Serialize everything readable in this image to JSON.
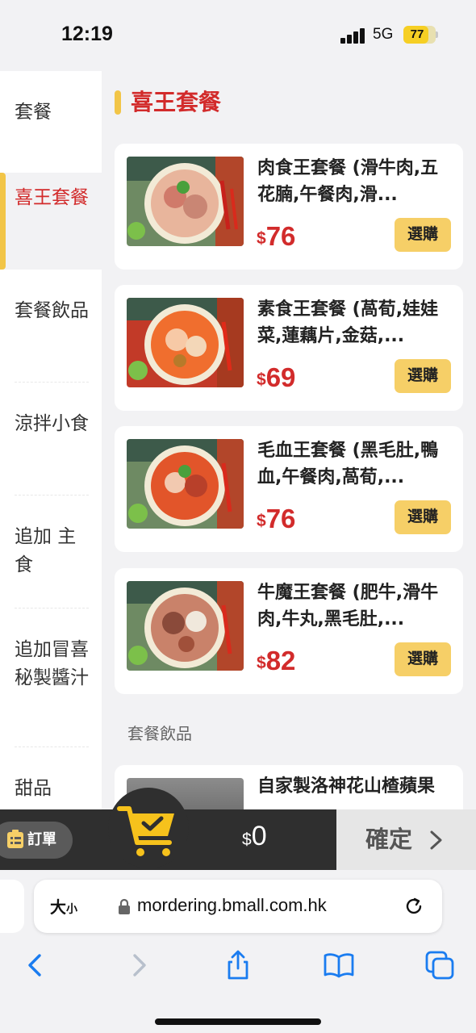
{
  "status": {
    "time": "12:19",
    "network": "5G",
    "battery": "77"
  },
  "sidebar": {
    "items": [
      {
        "label": "套餐",
        "active": false
      },
      {
        "label": "喜王套餐",
        "active": true
      },
      {
        "label": "套餐飲品",
        "active": false
      },
      {
        "label": "涼拌小食",
        "active": false
      },
      {
        "label": "追加 主食",
        "active": false
      },
      {
        "label": "追加冒喜秘製醬汁",
        "active": false
      },
      {
        "label": "甜品",
        "active": false
      }
    ]
  },
  "section": {
    "title": "喜王套餐"
  },
  "products": [
    {
      "name": "肉食王套餐 (滑牛肉,五花腩,午餐肉,滑...",
      "currency": "$",
      "price": "76",
      "button": "選購"
    },
    {
      "name": "素食王套餐 (萵荀,娃娃菜,蓮藕片,金菇,...",
      "currency": "$",
      "price": "69",
      "button": "選購"
    },
    {
      "name": "毛血王套餐 (黑毛肚,鴨血,午餐肉,萵荀,...",
      "currency": "$",
      "price": "76",
      "button": "選購"
    },
    {
      "name": "牛魔王套餐 (肥牛,滑牛肉,牛丸,黑毛肚,...",
      "currency": "$",
      "price": "82",
      "button": "選購"
    }
  ],
  "next_section": {
    "title": "套餐飲品",
    "first_item": "自家製洛神花山楂蘋果"
  },
  "cart": {
    "order_label": "訂單",
    "currency": "$",
    "total": "0",
    "confirm_label": "確定"
  },
  "browser": {
    "text_size_label": "大",
    "text_size_small": "小",
    "url": "mordering.bmall.com.hk"
  },
  "icons": {
    "cart": "shopping-cart-check-icon",
    "order": "clipboard-list-icon",
    "back": "chevron-left-icon",
    "forward": "chevron-right-icon",
    "share": "share-icon",
    "bookmarks": "book-icon",
    "tabs": "tabs-icon"
  },
  "colors": {
    "accent_red": "#d22b2b",
    "accent_yellow": "#f2c547",
    "button_yellow": "#f6cf67",
    "link_blue": "#1a7cf0"
  }
}
